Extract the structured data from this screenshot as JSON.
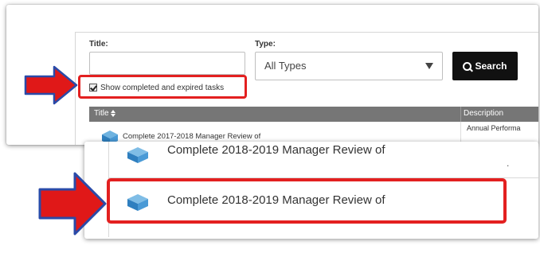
{
  "filters": {
    "title_label": "Title:",
    "title_value": "",
    "type_label": "Type:",
    "type_value": "All Types",
    "search_label": "Search",
    "show_completed_label": "Show completed and expired tasks",
    "show_completed_checked": true
  },
  "table": {
    "columns": [
      "Title",
      "Description"
    ],
    "rows": [
      {
        "title": "Complete 2017-2018 Manager Review of",
        "description": "Annual Performa"
      }
    ]
  },
  "zoomed_rows": [
    {
      "title": "Complete 2018-2019 Manager Review of",
      "extra": "."
    },
    {
      "title": "Complete 2018-2019 Manager Review of"
    }
  ],
  "colors": {
    "highlight": "#e32020",
    "header_bg": "#767676",
    "search_button_bg": "#111111"
  },
  "icons": [
    "book-icon",
    "search-icon",
    "sort-icon",
    "arrow-icon"
  ]
}
